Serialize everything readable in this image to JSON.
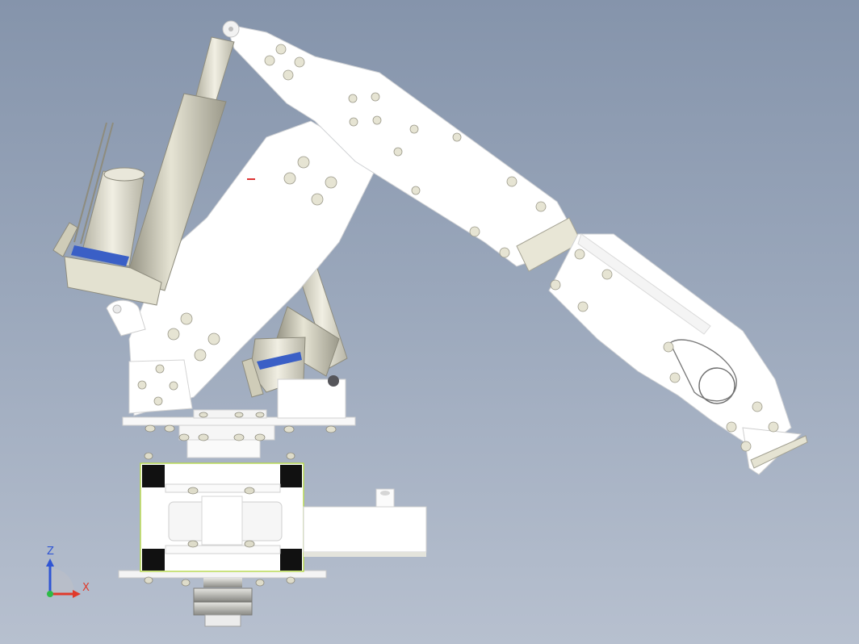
{
  "viewport": {
    "background_top": "#8594ab",
    "background_bottom": "#b7c0cf"
  },
  "model": {
    "part_color": "#ffffff",
    "edge_color": "#c9cbcf",
    "actuator_color": "#d8d6c4",
    "band_color": "#3a5fc6",
    "block_color": "#111111",
    "frame_outline_color": "#b6d94a"
  },
  "triad": {
    "z_label": "Z",
    "x_label": "X",
    "z_color": "#2f55d4",
    "x_color": "#e03a2b",
    "y_color": "#2dbb46",
    "z_icon": "axis-arrow-z",
    "x_icon": "axis-arrow-x"
  }
}
